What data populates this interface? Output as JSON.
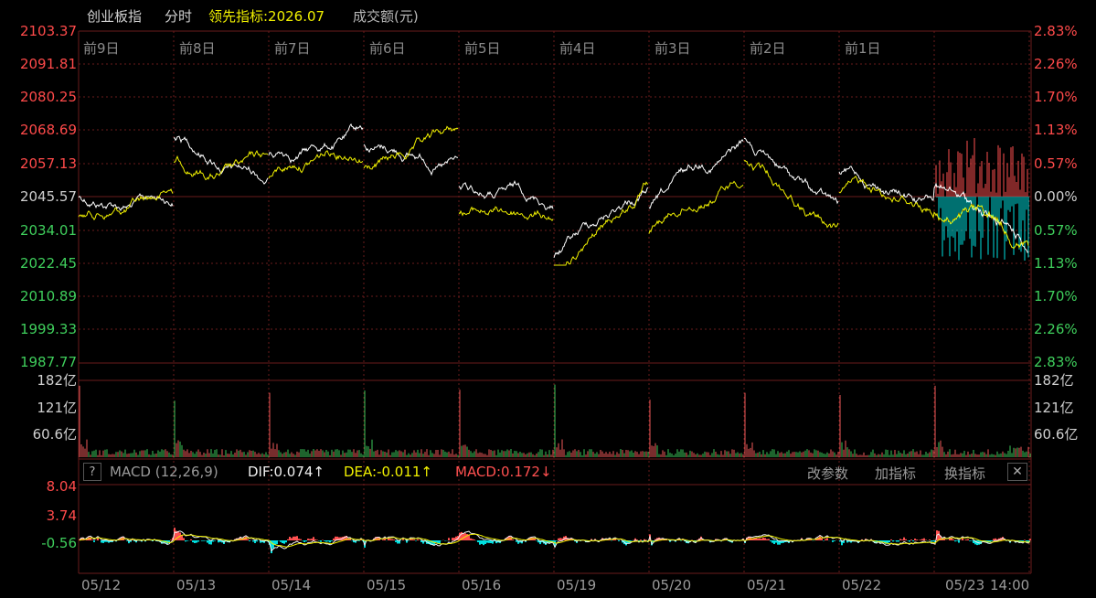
{
  "header": {
    "index_name": "创业板指",
    "mode": "分时",
    "leading_indicator": "领先指标:2026.07",
    "turnover": "成交额(元)"
  },
  "price_axis_left": [
    "2103.37",
    "2091.81",
    "2080.25",
    "2068.69",
    "2057.13",
    "2045.57",
    "2034.01",
    "2022.45",
    "2010.89",
    "1999.33",
    "1987.77"
  ],
  "price_axis_right": [
    "2.83%",
    "2.26%",
    "1.70%",
    "1.13%",
    "0.57%",
    "0.00%",
    "0.57%",
    "1.13%",
    "1.70%",
    "2.26%",
    "2.83%"
  ],
  "day_labels": [
    "前9日",
    "前8日",
    "前7日",
    "前6日",
    "前5日",
    "前4日",
    "前3日",
    "前2日",
    "前1日"
  ],
  "volume_axis_left": [
    "182亿",
    "121亿",
    "60.6亿"
  ],
  "volume_axis_right": [
    "182亿",
    "121亿",
    "60.6亿"
  ],
  "macd": {
    "help": "?",
    "name": "MACD (12,26,9)",
    "dif": "DIF:0.074↑",
    "dea": "DEA:-0.011↑",
    "macd": "MACD:0.172↓",
    "modify_params": "改参数",
    "add_indicator": "加指标",
    "switch_indicator": "换指标",
    "close": "✕",
    "axis": [
      "8.04",
      "3.74",
      "-0.56"
    ]
  },
  "dates": [
    "05/12",
    "05/13",
    "05/14",
    "05/15",
    "05/16",
    "05/19",
    "05/20",
    "05/21",
    "05/22",
    "05/23",
    "14:00"
  ],
  "colors": {
    "background": "#000000",
    "up": "#ff5050",
    "down": "#00e0e0",
    "volume_up": "#f05a5a",
    "volume_down": "#3cc85a",
    "white_line": "#ffffff",
    "yellow_line": "#f0f000",
    "grid": "#6a1b1b",
    "axis_up": "#ff4a4a",
    "axis_down": "#3fcf5c"
  }
}
